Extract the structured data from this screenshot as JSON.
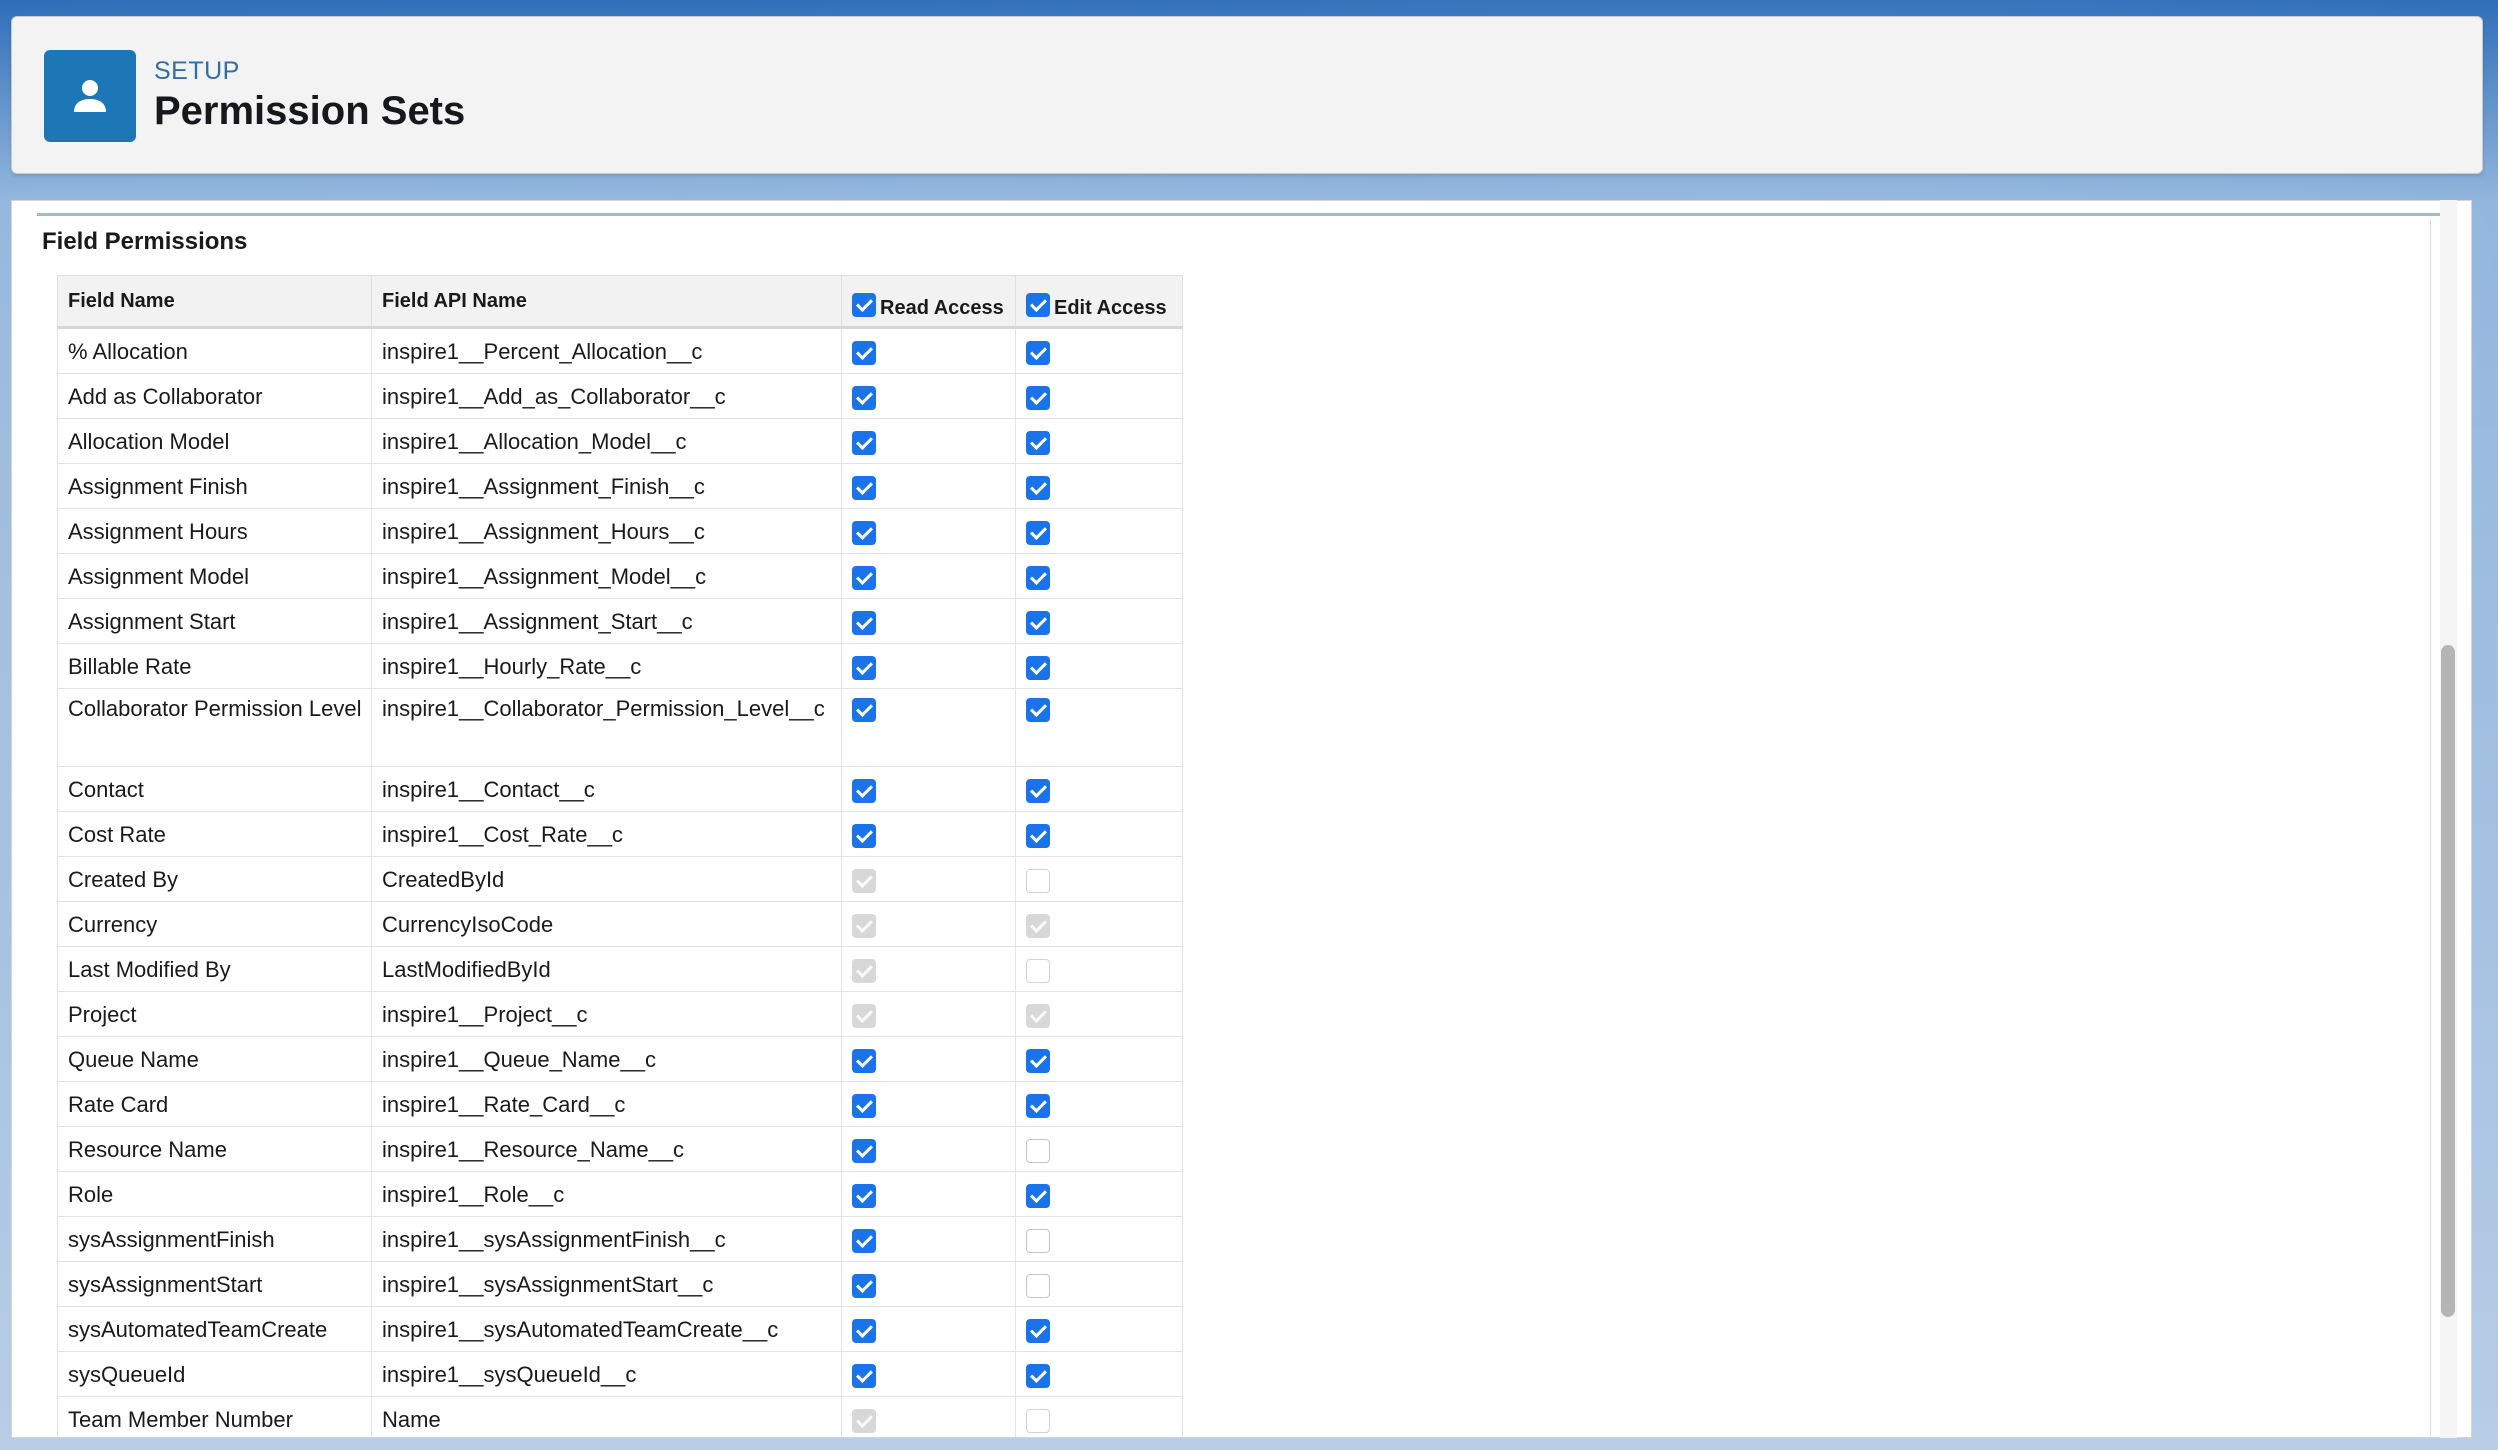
{
  "header": {
    "setup_label": "SETUP",
    "title": "Permission Sets"
  },
  "section": {
    "title": "Field Permissions"
  },
  "table": {
    "columns": {
      "field_name": "Field Name",
      "api_name": "Field API Name",
      "read_access": "Read Access",
      "edit_access": "Edit Access"
    },
    "header_checkboxes": {
      "read_all": true,
      "edit_all": true
    },
    "rows": [
      {
        "name": "% Allocation",
        "api": "inspire1__Percent_Allocation__c",
        "read": "on",
        "edit": "on"
      },
      {
        "name": "Add as Collaborator",
        "api": "inspire1__Add_as_Collaborator__c",
        "read": "on",
        "edit": "on"
      },
      {
        "name": "Allocation Model",
        "api": "inspire1__Allocation_Model__c",
        "read": "on",
        "edit": "on"
      },
      {
        "name": "Assignment Finish",
        "api": "inspire1__Assignment_Finish__c",
        "read": "on",
        "edit": "on"
      },
      {
        "name": "Assignment Hours",
        "api": "inspire1__Assignment_Hours__c",
        "read": "on",
        "edit": "on"
      },
      {
        "name": "Assignment Model",
        "api": "inspire1__Assignment_Model__c",
        "read": "on",
        "edit": "on"
      },
      {
        "name": "Assignment Start",
        "api": "inspire1__Assignment_Start__c",
        "read": "on",
        "edit": "on"
      },
      {
        "name": "Billable Rate",
        "api": "inspire1__Hourly_Rate__c",
        "read": "on",
        "edit": "on"
      },
      {
        "name": "Collaborator Permission Level",
        "api": "inspire1__Collaborator_Permission_Level__c",
        "read": "on",
        "edit": "on"
      },
      {
        "name": "Contact",
        "api": "inspire1__Contact__c",
        "read": "on",
        "edit": "on"
      },
      {
        "name": "Cost Rate",
        "api": "inspire1__Cost_Rate__c",
        "read": "on",
        "edit": "on"
      },
      {
        "name": "Created By",
        "api": "CreatedById",
        "read": "dis-on",
        "edit": "dis-off"
      },
      {
        "name": "Currency",
        "api": "CurrencyIsoCode",
        "read": "dis-on",
        "edit": "dis-on"
      },
      {
        "name": "Last Modified By",
        "api": "LastModifiedById",
        "read": "dis-on",
        "edit": "dis-off"
      },
      {
        "name": "Project",
        "api": "inspire1__Project__c",
        "read": "dis-on",
        "edit": "dis-on"
      },
      {
        "name": "Queue Name",
        "api": "inspire1__Queue_Name__c",
        "read": "on",
        "edit": "on"
      },
      {
        "name": "Rate Card",
        "api": "inspire1__Rate_Card__c",
        "read": "on",
        "edit": "on"
      },
      {
        "name": "Resource Name",
        "api": "inspire1__Resource_Name__c",
        "read": "on",
        "edit": "off"
      },
      {
        "name": "Role",
        "api": "inspire1__Role__c",
        "read": "on",
        "edit": "on"
      },
      {
        "name": "sysAssignmentFinish",
        "api": "inspire1__sysAssignmentFinish__c",
        "read": "on",
        "edit": "off"
      },
      {
        "name": "sysAssignmentStart",
        "api": "inspire1__sysAssignmentStart__c",
        "read": "on",
        "edit": "off"
      },
      {
        "name": "sysAutomatedTeamCreate",
        "api": "inspire1__sysAutomatedTeamCreate__c",
        "read": "on",
        "edit": "on"
      },
      {
        "name": "sysQueueId",
        "api": "inspire1__sysQueueId__c",
        "read": "on",
        "edit": "on"
      },
      {
        "name": "Team Member Number",
        "api": "Name",
        "read": "dis-on",
        "edit": "dis-off"
      }
    ]
  },
  "colors": {
    "accent": "#1a73e8",
    "header_icon": "#1d77b7",
    "setup_label": "#2f6ea8"
  },
  "icons": {
    "header": "user-icon"
  }
}
